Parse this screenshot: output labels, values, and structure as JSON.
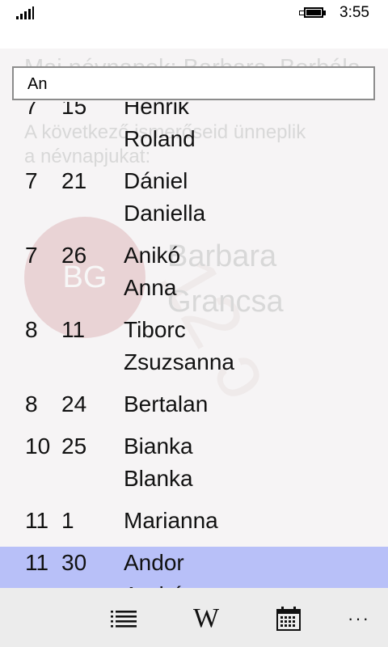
{
  "status_bar": {
    "time": "3:55"
  },
  "background": {
    "todays_namedays": "Mai névnapok:  Barbara, Borbála.",
    "contacts_line1": "A következő ismerőseid ünneplik",
    "contacts_line2": "a névnapjukat:",
    "contact_initials": "BG",
    "contact_first_name": "Barbara",
    "contact_last_name": "Grancsa"
  },
  "search": {
    "value": "An"
  },
  "list": {
    "rows": [
      {
        "month": "7",
        "day": "15",
        "names": [
          "Henrik",
          "Roland"
        ]
      },
      {
        "month": "7",
        "day": "21",
        "names": [
          "Dániel",
          "Daniella"
        ]
      },
      {
        "month": "7",
        "day": "26",
        "names": [
          "Anikó",
          "Anna"
        ]
      },
      {
        "month": "8",
        "day": "11",
        "names": [
          "Tiborc",
          "Zsuzsanna"
        ]
      },
      {
        "month": "8",
        "day": "24",
        "names": [
          "Bertalan"
        ]
      },
      {
        "month": "10",
        "day": "25",
        "names": [
          "Bianka",
          "Blanka"
        ]
      },
      {
        "month": "11",
        "day": "1",
        "names": [
          "Marianna"
        ]
      },
      {
        "month": "11",
        "day": "30",
        "names": [
          "Andor",
          "András"
        ],
        "selected": true
      }
    ]
  },
  "app_bar": {
    "buttons": [
      {
        "name": "list-icon"
      },
      {
        "name": "wikipedia-icon",
        "glyph": "W"
      },
      {
        "name": "calendar-icon"
      },
      {
        "name": "more-icon",
        "glyph": "···"
      }
    ]
  },
  "colors": {
    "selected_row": "#b8c0f8",
    "app_bar": "#ececec"
  }
}
